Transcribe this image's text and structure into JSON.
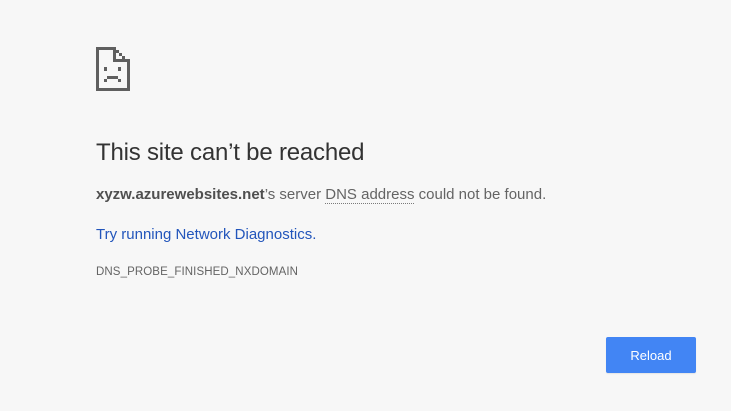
{
  "error_page": {
    "icon": "sad-document-icon",
    "title": "This site can’t be reached",
    "message": {
      "host": "xyzw.azurewebsites.net",
      "part1": "’s server ",
      "abbr": "DNS address",
      "part2": " could not be found."
    },
    "diagnostics_link": "Try running Network Diagnostics.",
    "error_code": "DNS_PROBE_FINISHED_NXDOMAIN",
    "reload_label": "Reload"
  },
  "colors": {
    "background": "#f7f7f7",
    "title": "#333333",
    "body_text": "#646464",
    "link": "#2255bb",
    "button": "#4285f4",
    "button_text": "#ffffff"
  }
}
